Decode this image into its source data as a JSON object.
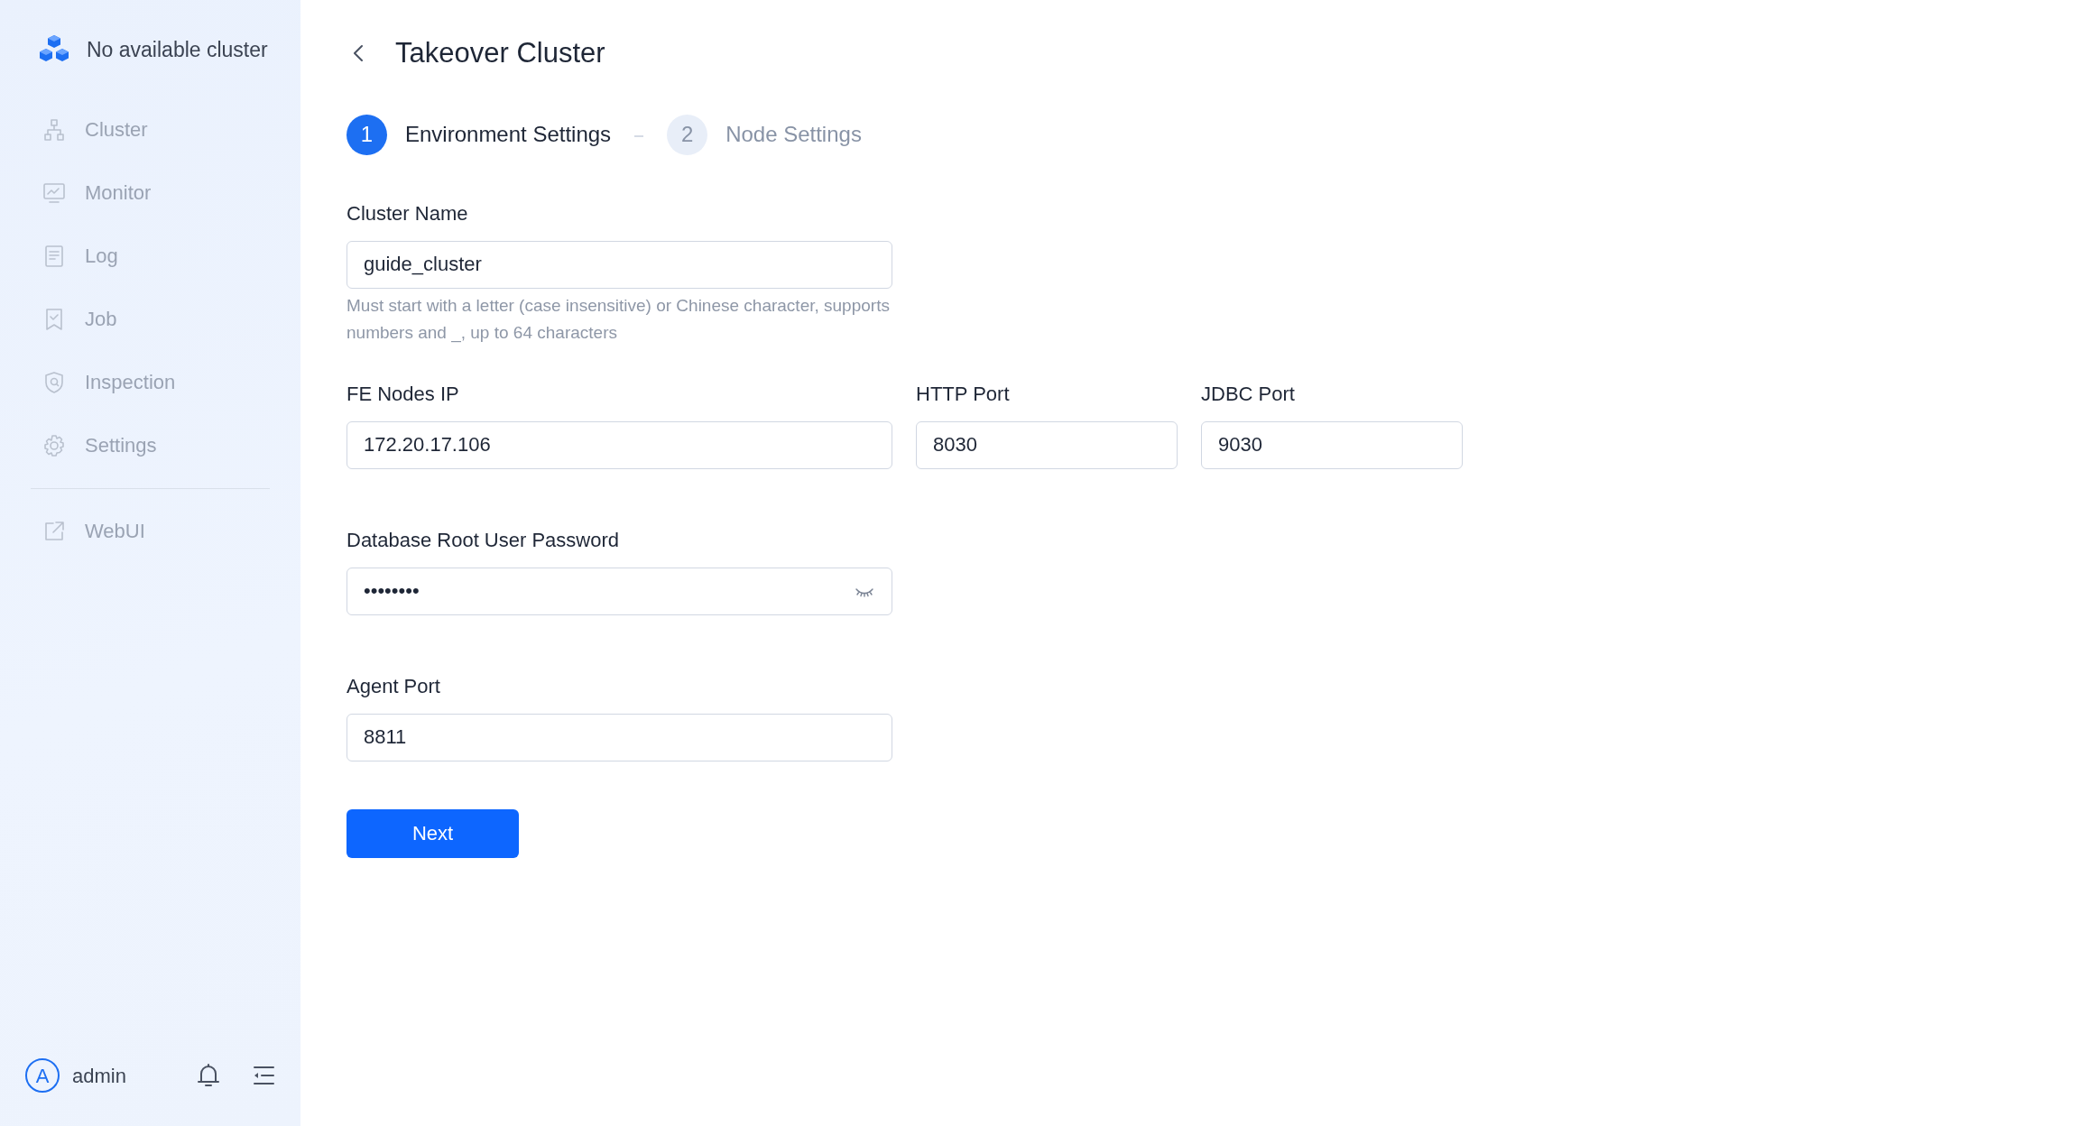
{
  "sidebar": {
    "cluster_name": "No available cluster",
    "items": [
      {
        "label": "Cluster",
        "disabled": true
      },
      {
        "label": "Monitor",
        "disabled": true
      },
      {
        "label": "Log",
        "disabled": true
      },
      {
        "label": "Job",
        "disabled": true
      },
      {
        "label": "Inspection",
        "disabled": true
      },
      {
        "label": "Settings",
        "disabled": true
      }
    ],
    "links": [
      {
        "label": "WebUI",
        "disabled": true
      }
    ],
    "user": {
      "avatar": "A",
      "name": "admin"
    }
  },
  "page": {
    "title": "Takeover Cluster"
  },
  "steps": [
    {
      "number": "1",
      "label": "Environment Settings",
      "selected": true
    },
    {
      "number": "2",
      "label": "Node Settings",
      "selected": false
    }
  ],
  "form": {
    "rows": [
      [
        {
          "label": "Cluster Name",
          "value": "guide_cluster",
          "help": "Must start with a letter (case insensitive) or Chinese character, supports numbers and _, up to 64 characters"
        }
      ],
      [
        {
          "label": "FE Nodes IP",
          "value": "172.20.17.106"
        },
        {
          "label": "HTTP Port",
          "value": "8030"
        },
        {
          "label": "JDBC Port",
          "value": "9030"
        }
      ],
      [
        {
          "label": "Database Root User Password",
          "value": "••••••••",
          "kind": "password"
        }
      ],
      [
        {
          "label": "Agent Port",
          "value": "8811"
        }
      ]
    ],
    "submit": "Next"
  }
}
